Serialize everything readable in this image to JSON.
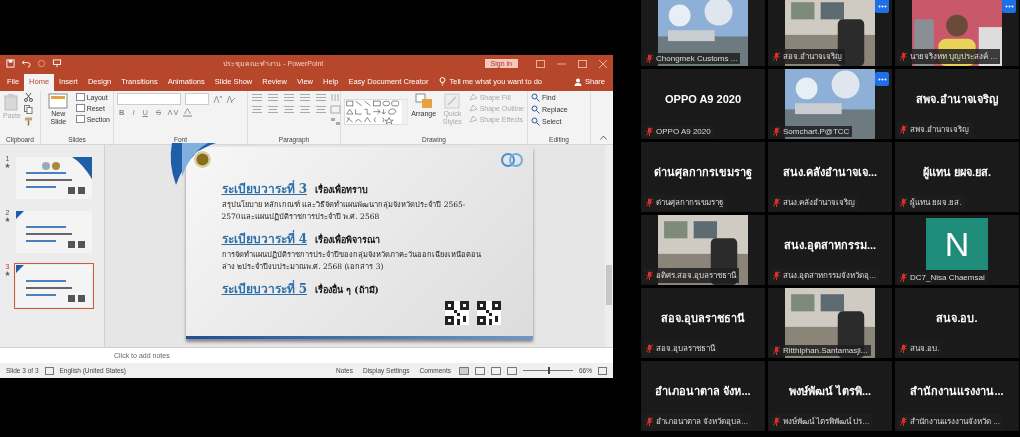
{
  "powerpoint": {
    "title": "ประชุมคณะทำงาน - PowerPoint",
    "sign_in": "Sign in",
    "tabs": [
      {
        "label": "File",
        "selected": false
      },
      {
        "label": "Home",
        "selected": true
      },
      {
        "label": "Insert",
        "selected": false
      },
      {
        "label": "Design",
        "selected": false
      },
      {
        "label": "Transitions",
        "selected": false
      },
      {
        "label": "Animations",
        "selected": false
      },
      {
        "label": "Slide Show",
        "selected": false
      },
      {
        "label": "Review",
        "selected": false
      },
      {
        "label": "View",
        "selected": false
      },
      {
        "label": "Help",
        "selected": false
      },
      {
        "label": "Easy Document Creator",
        "selected": false
      }
    ],
    "tell_me": "Tell me what you want to do",
    "share": "Share",
    "ribbon_groups": [
      {
        "kind": "clipboard",
        "label": "Clipboard",
        "commands": [
          {
            "label": "Paste",
            "disabled": true
          }
        ]
      },
      {
        "kind": "slides",
        "label": "Slides",
        "commands": [
          {
            "label": "New Slide",
            "disabled": false
          },
          {
            "label": "Layout",
            "disabled": false
          },
          {
            "label": "Reset",
            "disabled": false
          },
          {
            "label": "Section",
            "disabled": false
          }
        ]
      },
      {
        "kind": "font",
        "label": "Font",
        "font_styles": [
          "B",
          "I",
          "U",
          "S"
        ]
      },
      {
        "kind": "paragraph",
        "label": "Paragraph"
      },
      {
        "kind": "drawing",
        "label": "Drawing",
        "commands": [
          {
            "label": "Arrange",
            "disabled": false
          },
          {
            "label": "Quick Styles",
            "disabled": true
          },
          {
            "label": "Shape Fill",
            "disabled": true
          },
          {
            "label": "Shape Outline",
            "disabled": true
          },
          {
            "label": "Shape Effects",
            "disabled": true
          }
        ]
      },
      {
        "kind": "editing",
        "label": "Editing",
        "commands": [
          {
            "label": "Find",
            "disabled": false
          },
          {
            "label": "Replace",
            "disabled": false
          },
          {
            "label": "Select",
            "disabled": false
          }
        ]
      }
    ],
    "thumbnails": [
      {
        "number": "1",
        "selected": false
      },
      {
        "number": "2",
        "selected": false
      },
      {
        "number": "3",
        "selected": true
      }
    ],
    "slide": {
      "items": [
        {
          "agenda": "ระเบียบวาระที่ 3",
          "topic": "เรื่องเพื่อทราบ",
          "detail": "สรุปนโยบาย หลักเกณฑ์ และวิธีจัดทำแผนพัฒนากลุ่มจังหวัดประจำปี 2565-2570และแผนปฏิบัติราชการประจำปี พ.ศ. 2568"
        },
        {
          "agenda": "ระเบียบวาระที่ 4",
          "topic": "เรื่องเพื่อพิจารณา",
          "detail": "การจัดทำแผนปฏิบัติราชการประจำปีของกลุ่มจังหวัดภาคะวันออกเฉียงเหนือตอนล่าง ๒ประจำปีงบประมาณพ.ศ. 2568 (เอกสาร 3)"
        },
        {
          "agenda": "ระเบียบวาระที่ 5",
          "topic": "เรื่องอื่น ๆ (ถ้ามี)"
        }
      ]
    },
    "notes_placeholder": "Click to add notes",
    "status_bar": {
      "slide": "Slide 3 of 3",
      "language": "English (United States)",
      "notes": "Notes",
      "display_settings": "Display Settings",
      "comments": "Comments",
      "zoom": "66%",
      "zoom_slider": {
        "level": 0.5
      }
    }
  },
  "participants": [
    {
      "kind": "video",
      "label": "Chongmek Customs ...",
      "muted": true,
      "more_button": false
    },
    {
      "kind": "video",
      "label": "สอจ.อำนาจเจริญ",
      "muted": true,
      "more_button": true
    },
    {
      "kind": "video",
      "label": "นายจริงหท บุญประสงค์ ...",
      "muted": true,
      "more_button": true
    },
    {
      "kind": "name",
      "title": "OPPO A9 2020",
      "label": "OPPO A9 2020",
      "muted": true,
      "more_button": false
    },
    {
      "kind": "video",
      "label": "Somchart.P@TCC",
      "muted": true,
      "more_button": true
    },
    {
      "kind": "name",
      "title": "สพจ.อำนาจเจริญ",
      "label": "สพจ.อำนาจเจริญ",
      "muted": true,
      "more_button": false
    },
    {
      "kind": "name",
      "title": "ด่านศุลกากรเขมราฐ",
      "label": "ด่านศุลกากรเขมราฐ",
      "muted": true,
      "more_button": false
    },
    {
      "kind": "name",
      "title": "สนง.คลังอำนาจเจ...",
      "label": "สนง.คลังอำนาจเจริญ",
      "muted": true,
      "more_button": false
    },
    {
      "kind": "name",
      "title": "ผู้แทน ยผจ.ยส.",
      "label": "ผู้แทน ยผจ.ยส.",
      "muted": true,
      "more_button": false
    },
    {
      "kind": "video",
      "label": "อดิศร.สอจ.อุบลราชธานี",
      "muted": true,
      "more_button": false
    },
    {
      "kind": "name",
      "title": "สนง.อุตสาหกรรม...",
      "label": "สนง.อุตสาหกรรมจังหวัดอุ...",
      "muted": true,
      "more_button": false
    },
    {
      "kind": "avatar",
      "initial": "N",
      "color": "#1e8c78",
      "label": "DC7_Nisa Chaemsai",
      "muted": true,
      "more_button": false
    },
    {
      "kind": "name",
      "title": "สอจ.อุบลราชธานี",
      "label": "สอจ.อุบลราชธานี",
      "muted": true,
      "more_button": false
    },
    {
      "kind": "video",
      "label": "Ritthiphan.Santamasji...",
      "muted": true,
      "more_button": false
    },
    {
      "kind": "name",
      "title": "สนจ.อบ.",
      "label": "สนจ.อบ.",
      "muted": true,
      "more_button": false
    },
    {
      "kind": "name",
      "title": "อำเภอนาตาล จังห...",
      "label": "อำเภอนาตาล จังหวัดอุบล...",
      "muted": true,
      "more_button": false
    },
    {
      "kind": "name",
      "title": "พงษ์พัฒน์ ไตรพิ...",
      "label": "พงษ์พัฒน์ ไตรพิพัฒน์ ปร...",
      "muted": true,
      "more_button": false
    },
    {
      "kind": "name",
      "title": "สำนักงานแรงงาน...",
      "label": "สำนักงานแรงงานจังหวัด ...",
      "muted": true,
      "more_button": false
    }
  ]
}
